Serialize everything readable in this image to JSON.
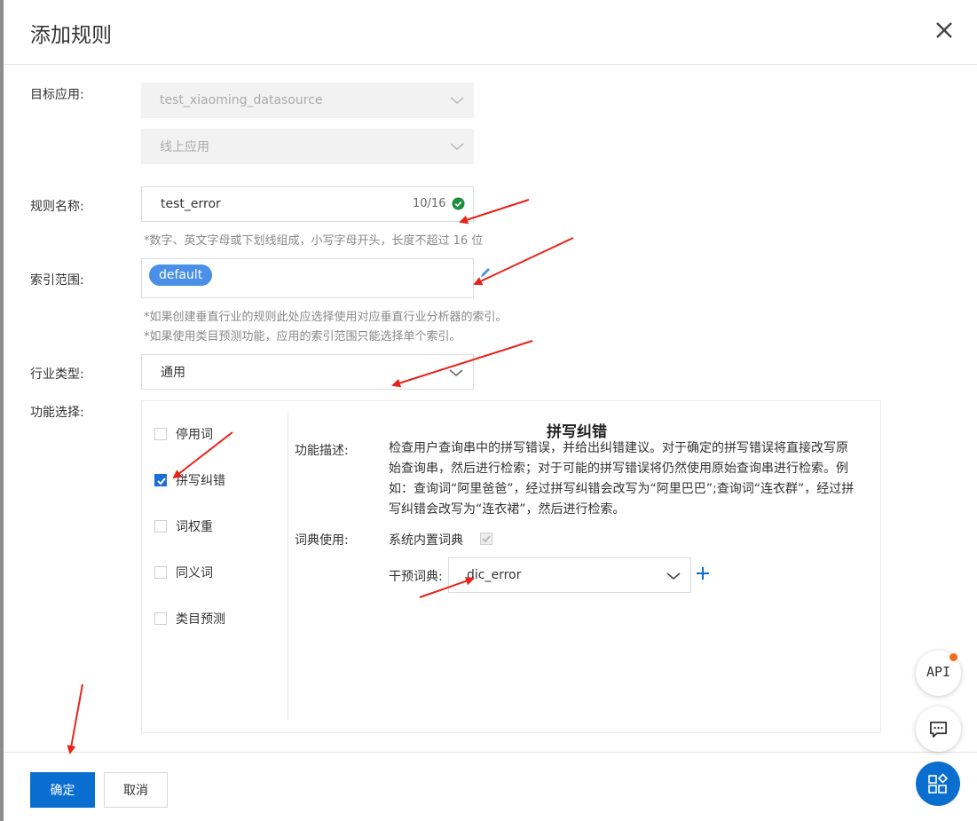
{
  "dialog": {
    "title": "添加规则"
  },
  "form": {
    "target_app": {
      "label": "目标应用:",
      "datasource_value": "test_xiaoming_datasource",
      "env_value": "线上应用"
    },
    "rule_name": {
      "label": "规则名称:",
      "value": "test_error",
      "counter": "10/16",
      "hint": "*数字、英文字母或下划线组成，小写字母开头，长度不超过 16 位"
    },
    "index_scope": {
      "label": "索引范围:",
      "tag": "default",
      "hint1": "*如果创建垂直行业的规则此处应选择使用对应垂直行业分析器的索引。",
      "hint2": "*如果使用类目预测功能，应用的索引范围只能选择单个索引。"
    },
    "industry": {
      "label": "行业类型:",
      "value": "通用"
    },
    "features": {
      "label": "功能选择:",
      "options": [
        {
          "label": "停用词",
          "checked": false
        },
        {
          "label": "拼写纠错",
          "checked": true
        },
        {
          "label": "词权重",
          "checked": false
        },
        {
          "label": "同义词",
          "checked": false
        },
        {
          "label": "类目预测",
          "checked": false
        }
      ],
      "detail": {
        "title": "拼写纠错",
        "desc_label": "功能描述:",
        "desc": "检查用户查询串中的拼写错误，并给出纠错建议。对于确定的拼写错误将直接改写原始查询串，然后进行检索；对于可能的拼写错误将仍然使用原始查询串进行检索。例如：查询词“阿里爸爸”，经过拼写纠错会改写为“阿里巴巴”;查询词“连衣群”，经过拼写纠错会改写为“连衣裙”，然后进行检索。",
        "dict_label": "词典使用:",
        "system_dict": "系统内置词典",
        "intervene_label": "干预词典:",
        "intervene_value": "dic_error"
      }
    }
  },
  "footer": {
    "confirm": "确定",
    "cancel": "取消"
  },
  "floating": {
    "api": "API"
  },
  "colors": {
    "primary": "#0a6ed1",
    "tag": "#4a90e8",
    "success": "#1e8e3e",
    "annotation": "#e8231a",
    "badge": "#f26c1b"
  }
}
